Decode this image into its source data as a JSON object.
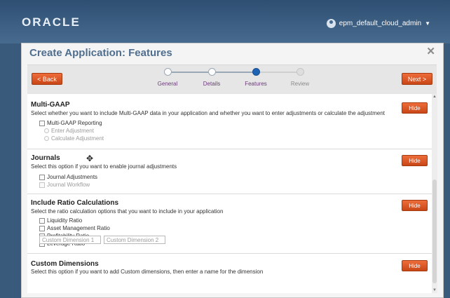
{
  "header": {
    "logo": "ORACLE",
    "user": "epm_default_cloud_admin"
  },
  "dialog": {
    "title": "Create Application: Features",
    "close": "✕"
  },
  "train": {
    "back_label": "< Back",
    "next_label": "Next >",
    "steps": [
      {
        "label": "General",
        "state": "done"
      },
      {
        "label": "Details",
        "state": "done"
      },
      {
        "label": "Features",
        "state": "active"
      },
      {
        "label": "Review",
        "state": "future"
      }
    ]
  },
  "sections": {
    "multigaap": {
      "title": "Multi-GAAP",
      "desc": "Select whether you want to include Multi-GAAP data in your application and whether you want to enter adjustments or calculate the adjustment",
      "hide": "Hide",
      "options": [
        "Multi-GAAP Reporting",
        "Enter Adjustment",
        "Calculate Adjustment"
      ]
    },
    "journals": {
      "title": "Journals",
      "desc": "Select this option if you want to enable journal adjustments",
      "hide": "Hide",
      "options": [
        "Journal Adjustments",
        "Journal Workflow"
      ]
    },
    "ratio": {
      "title": "Include Ratio Calculations",
      "desc": "Select the ratio calculation options that you want to include in your application",
      "hide": "Hide",
      "options": [
        "Liquidity Ratio",
        "Asset Management Ratio",
        "Profitability Ratio",
        "Leverage Ratio"
      ]
    },
    "custom": {
      "title": "Custom Dimensions",
      "desc": "Select this option if you want to add Custom dimensions, then enter a name for the dimension",
      "hide": "Hide",
      "inputs": [
        "Custom Dimension 1",
        "Custom Dimension 2"
      ]
    }
  }
}
